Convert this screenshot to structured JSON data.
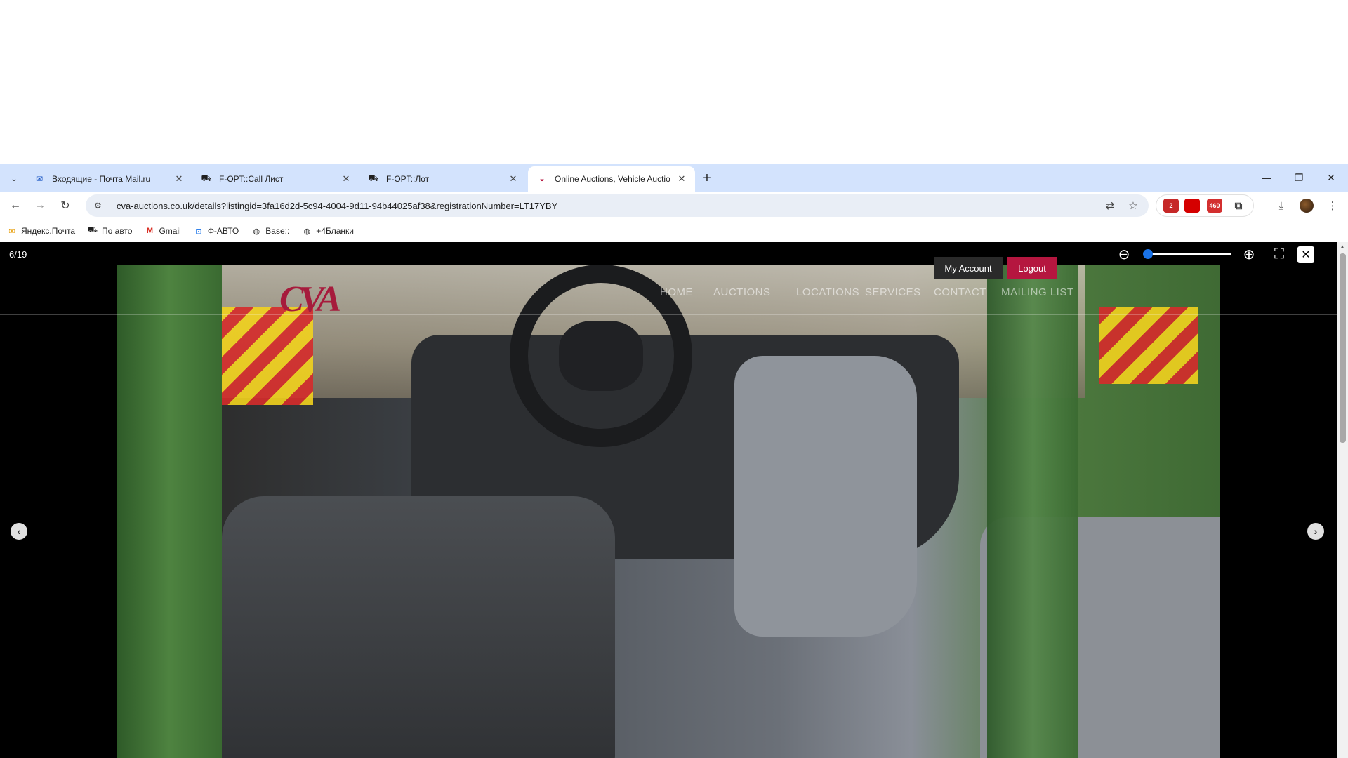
{
  "browser": {
    "tabs": [
      {
        "title": "Входящие - Почта Mail.ru",
        "icon": "mail-icon",
        "active": false
      },
      {
        "title": "F-OPT::Call Лист",
        "icon": "car-icon",
        "active": false
      },
      {
        "title": "F-OPT::Лот",
        "icon": "car-icon",
        "active": false
      },
      {
        "title": "Online Auctions, Vehicle Auctio",
        "icon": "cva-icon",
        "active": true
      }
    ],
    "url": "cva-auctions.co.uk/details?listingid=3fa16d2d-5c94-4004-9d11-94b44025af38&registrationNumber=LT17YBY",
    "extensions": [
      {
        "name": "shield-extension",
        "badge": "2"
      },
      {
        "name": "ext-red",
        "badge": ""
      },
      {
        "name": "ext-460",
        "badge": "460"
      }
    ],
    "bookmarks": [
      {
        "label": "Яндекс.Почта",
        "icon": "mail-icon"
      },
      {
        "label": "По авто",
        "icon": "car-icon"
      },
      {
        "label": "Gmail",
        "icon": "gmail-icon"
      },
      {
        "label": "Ф-АВТО",
        "icon": "app-icon"
      },
      {
        "label": "Base::",
        "icon": "globe-icon"
      },
      {
        "label": "+4Бланки",
        "icon": "globe-icon"
      }
    ]
  },
  "page": {
    "counter": "6/19",
    "logo_text": "CVA",
    "nav": [
      "HOME",
      "AUCTIONS",
      "LOCATIONS",
      "SERVICES",
      "CONTACT",
      "MAILING LIST"
    ],
    "account_label": "My Account",
    "logout_label": "Logout",
    "zoom_level": 0.0
  },
  "colors": {
    "tabstrip": "#d3e3fd",
    "logout": "#b5163f",
    "accent": "#1a73e8"
  }
}
